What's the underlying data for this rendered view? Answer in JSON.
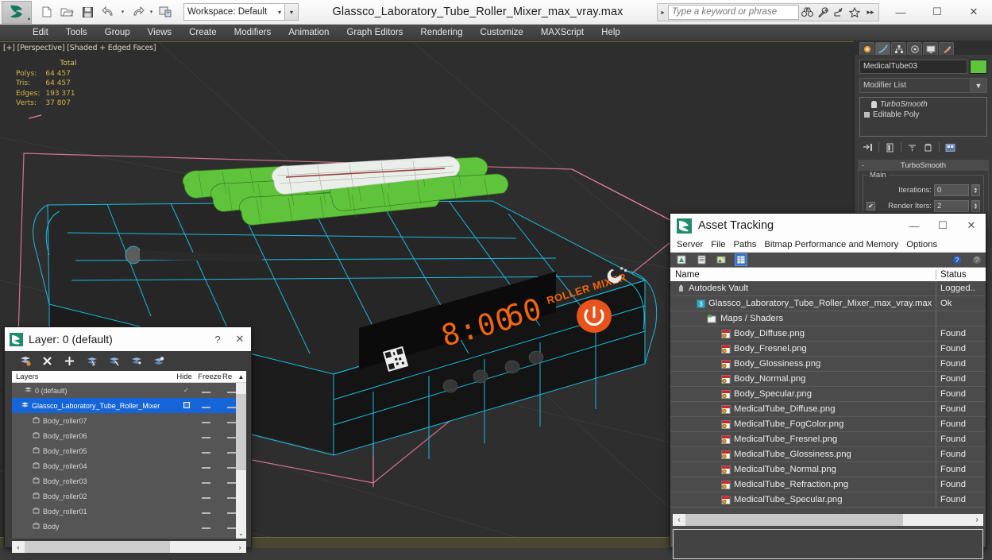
{
  "titlebar": {
    "workspace_label": "Workspace: Default",
    "document_title": "Glassco_Laboratory_Tube_Roller_Mixer_max_vray.max",
    "search_placeholder": "Type a keyword or phrase",
    "minimize_label": "—",
    "maximize_label": "☐",
    "close_label": "✕",
    "qat_icons": [
      "new-file-icon",
      "open-file-icon",
      "save-file-icon",
      "undo-icon",
      "redo-icon",
      "set-reference-coordinate-icon"
    ],
    "search_icons": [
      "binoculars-icon",
      "wrench-icon",
      "satellite-icon",
      "star-icon",
      "more-icon"
    ]
  },
  "menubar": {
    "items": [
      "Edit",
      "Tools",
      "Group",
      "Views",
      "Create",
      "Modifiers",
      "Animation",
      "Graph Editors",
      "Rendering",
      "Customize",
      "MAXScript",
      "Help"
    ]
  },
  "viewport": {
    "label": "[+] [Perspective] [Shaded + Edged Faces]",
    "stats": {
      "col_header": "Total",
      "rows": [
        {
          "label": "Polys:",
          "value": "64 457"
        },
        {
          "label": "Tris:",
          "value": "64 457"
        },
        {
          "label": "Edges:",
          "value": "193 371"
        },
        {
          "label": "Verts:",
          "value": "37 807"
        }
      ]
    },
    "model": {
      "brand_text": "ROLLER MIXER",
      "display_time": "8:00",
      "display_speed": "60",
      "power_button": "power-icon"
    }
  },
  "command_panel": {
    "tabs": [
      "create-tab",
      "modify-tab",
      "hierarchy-tab",
      "motion-tab",
      "display-tab",
      "utilities-tab"
    ],
    "active_tab": "modify-tab",
    "object_name": "MedicalTube03",
    "object_color": "#5fc33c",
    "modifier_list_label": "Modifier List",
    "stack": [
      {
        "name": "TurboSmooth",
        "italic": true
      },
      {
        "name": "Editable Poly",
        "italic": false
      }
    ],
    "rollout": {
      "title": "TurboSmooth",
      "group_label": "Main",
      "fields": [
        {
          "label": "Iterations:",
          "value": "0"
        },
        {
          "label": "Render Iters:",
          "value": "2"
        }
      ],
      "render_iters_checked": true
    }
  },
  "layer_dialog": {
    "title": "Layer: 0 (default)",
    "help_label": "?",
    "close_label": "✕",
    "toolbar_icons": [
      "new-layer-icon",
      "delete-layer-icon",
      "add-layer-icon",
      "select-objects-icon",
      "select-highlight-icon",
      "add-selection-icon",
      "set-current-icon"
    ],
    "columns": [
      "Layers",
      "",
      "Hide",
      "Freeze",
      "Re"
    ],
    "rows": [
      {
        "name": "0 (default)",
        "indent": 0,
        "check": "✓",
        "hide": "—",
        "freeze": "—",
        "selected": false
      },
      {
        "name": "Glassco_Laboratory_Tube_Roller_Mixer",
        "indent": 0,
        "check": "box",
        "hide": "—",
        "freeze": "—",
        "selected": true
      },
      {
        "name": "Body_roller07",
        "indent": 1,
        "check": "",
        "hide": "—",
        "freeze": "—",
        "selected": false
      },
      {
        "name": "Body_roller06",
        "indent": 1,
        "check": "",
        "hide": "—",
        "freeze": "—",
        "selected": false
      },
      {
        "name": "Body_roller05",
        "indent": 1,
        "check": "",
        "hide": "—",
        "freeze": "—",
        "selected": false
      },
      {
        "name": "Body_roller04",
        "indent": 1,
        "check": "",
        "hide": "—",
        "freeze": "—",
        "selected": false
      },
      {
        "name": "Body_roller03",
        "indent": 1,
        "check": "",
        "hide": "—",
        "freeze": "—",
        "selected": false
      },
      {
        "name": "Body_roller02",
        "indent": 1,
        "check": "",
        "hide": "—",
        "freeze": "—",
        "selected": false
      },
      {
        "name": "Body_roller01",
        "indent": 1,
        "check": "",
        "hide": "—",
        "freeze": "—",
        "selected": false
      },
      {
        "name": "Body",
        "indent": 1,
        "check": "",
        "hide": "—",
        "freeze": "—",
        "selected": false
      }
    ],
    "scroll_up": "⌃",
    "scroll_down": "⌄",
    "hscroll_left": "‹",
    "hscroll_right": "›"
  },
  "asset_tracking": {
    "title": "Asset Tracking",
    "minimize_label": "—",
    "maximize_label": "☐",
    "close_label": "✕",
    "menus": [
      "Server",
      "File",
      "Paths",
      "Bitmap Performance and Memory",
      "Options"
    ],
    "toolbar_icons": [
      "refresh-icon",
      "list-view-icon",
      "thumbnail-view-icon",
      "table-view-icon"
    ],
    "toolbar_right_icons": [
      "help-icon",
      "about-icon"
    ],
    "active_toolbar_icon": "table-view-icon",
    "columns": [
      "Name",
      "Status"
    ],
    "rows": [
      {
        "name": "Autodesk Vault",
        "status": "Logged..",
        "indent": 0,
        "icon": "vault-icon"
      },
      {
        "name": "Glassco_Laboratory_Tube_Roller_Mixer_max_vray.max",
        "status": "Ok",
        "indent": 1,
        "icon": "max-file-icon"
      },
      {
        "name": "Maps / Shaders",
        "status": "",
        "indent": 2,
        "icon": "maps-folder-icon"
      },
      {
        "name": "Body_Diffuse.png",
        "status": "Found",
        "indent": 3,
        "icon": "png-file-icon"
      },
      {
        "name": "Body_Fresnel.png",
        "status": "Found",
        "indent": 3,
        "icon": "png-file-icon"
      },
      {
        "name": "Body_Glossiness.png",
        "status": "Found",
        "indent": 3,
        "icon": "png-file-icon"
      },
      {
        "name": "Body_Normal.png",
        "status": "Found",
        "indent": 3,
        "icon": "png-file-icon"
      },
      {
        "name": "Body_Specular.png",
        "status": "Found",
        "indent": 3,
        "icon": "png-file-icon"
      },
      {
        "name": "MedicalTube_Diffuse.png",
        "status": "Found",
        "indent": 3,
        "icon": "png-file-icon"
      },
      {
        "name": "MedicalTube_FogColor.png",
        "status": "Found",
        "indent": 3,
        "icon": "png-file-icon"
      },
      {
        "name": "MedicalTube_Fresnel.png",
        "status": "Found",
        "indent": 3,
        "icon": "png-file-icon"
      },
      {
        "name": "MedicalTube_Glossiness.png",
        "status": "Found",
        "indent": 3,
        "icon": "png-file-icon"
      },
      {
        "name": "MedicalTube_Normal.png",
        "status": "Found",
        "indent": 3,
        "icon": "png-file-icon"
      },
      {
        "name": "MedicalTube_Refraction.png",
        "status": "Found",
        "indent": 3,
        "icon": "png-file-icon"
      },
      {
        "name": "MedicalTube_Specular.png",
        "status": "Found",
        "indent": 3,
        "icon": "png-file-icon"
      }
    ],
    "hscroll_left": "‹",
    "hscroll_right": "›"
  },
  "colors": {
    "accent_green": "#5fc33c",
    "wire_cyan": "#19c3e8",
    "gizmo_pink": "#f07e9e",
    "led_orange": "#f2650f",
    "stats_gold": "#d4b44a",
    "selection_blue": "#1565d8"
  }
}
